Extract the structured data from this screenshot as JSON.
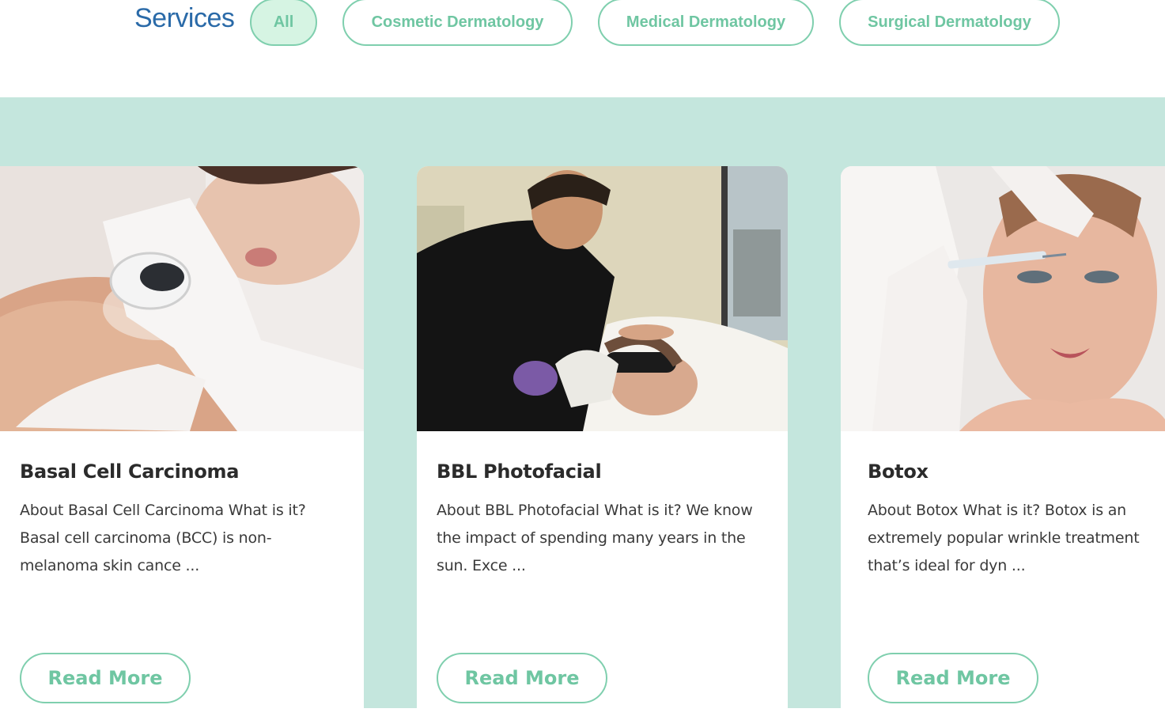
{
  "filters": {
    "title": "Services",
    "items": [
      {
        "label": "All",
        "active": true
      },
      {
        "label": "Cosmetic Dermatology",
        "active": false
      },
      {
        "label": "Medical Dermatology",
        "active": false
      },
      {
        "label": "Surgical Dermatology",
        "active": false
      }
    ]
  },
  "cards": [
    {
      "title": "Basal Cell Carcinoma",
      "excerpt": "About Basal Cell Carcinoma What is it? Basal cell carcinoma (BCC) is non-melanoma skin cance ...",
      "button": "Read More"
    },
    {
      "title": "BBL Photofacial",
      "excerpt": "About BBL Photofacial What is it? We know the impact of spending many years in the sun. Exce ...",
      "button": "Read More"
    },
    {
      "title": "Botox",
      "excerpt": "About Botox What is it? Botox is an extremely popular wrinkle treatment that’s ideal for dyn ...",
      "button": "Read More"
    }
  ],
  "colors": {
    "accent": "#7fcfae",
    "accent_text": "#6fc6a2",
    "band": "#c4e6dd",
    "title_blue": "#2a6aa8"
  }
}
